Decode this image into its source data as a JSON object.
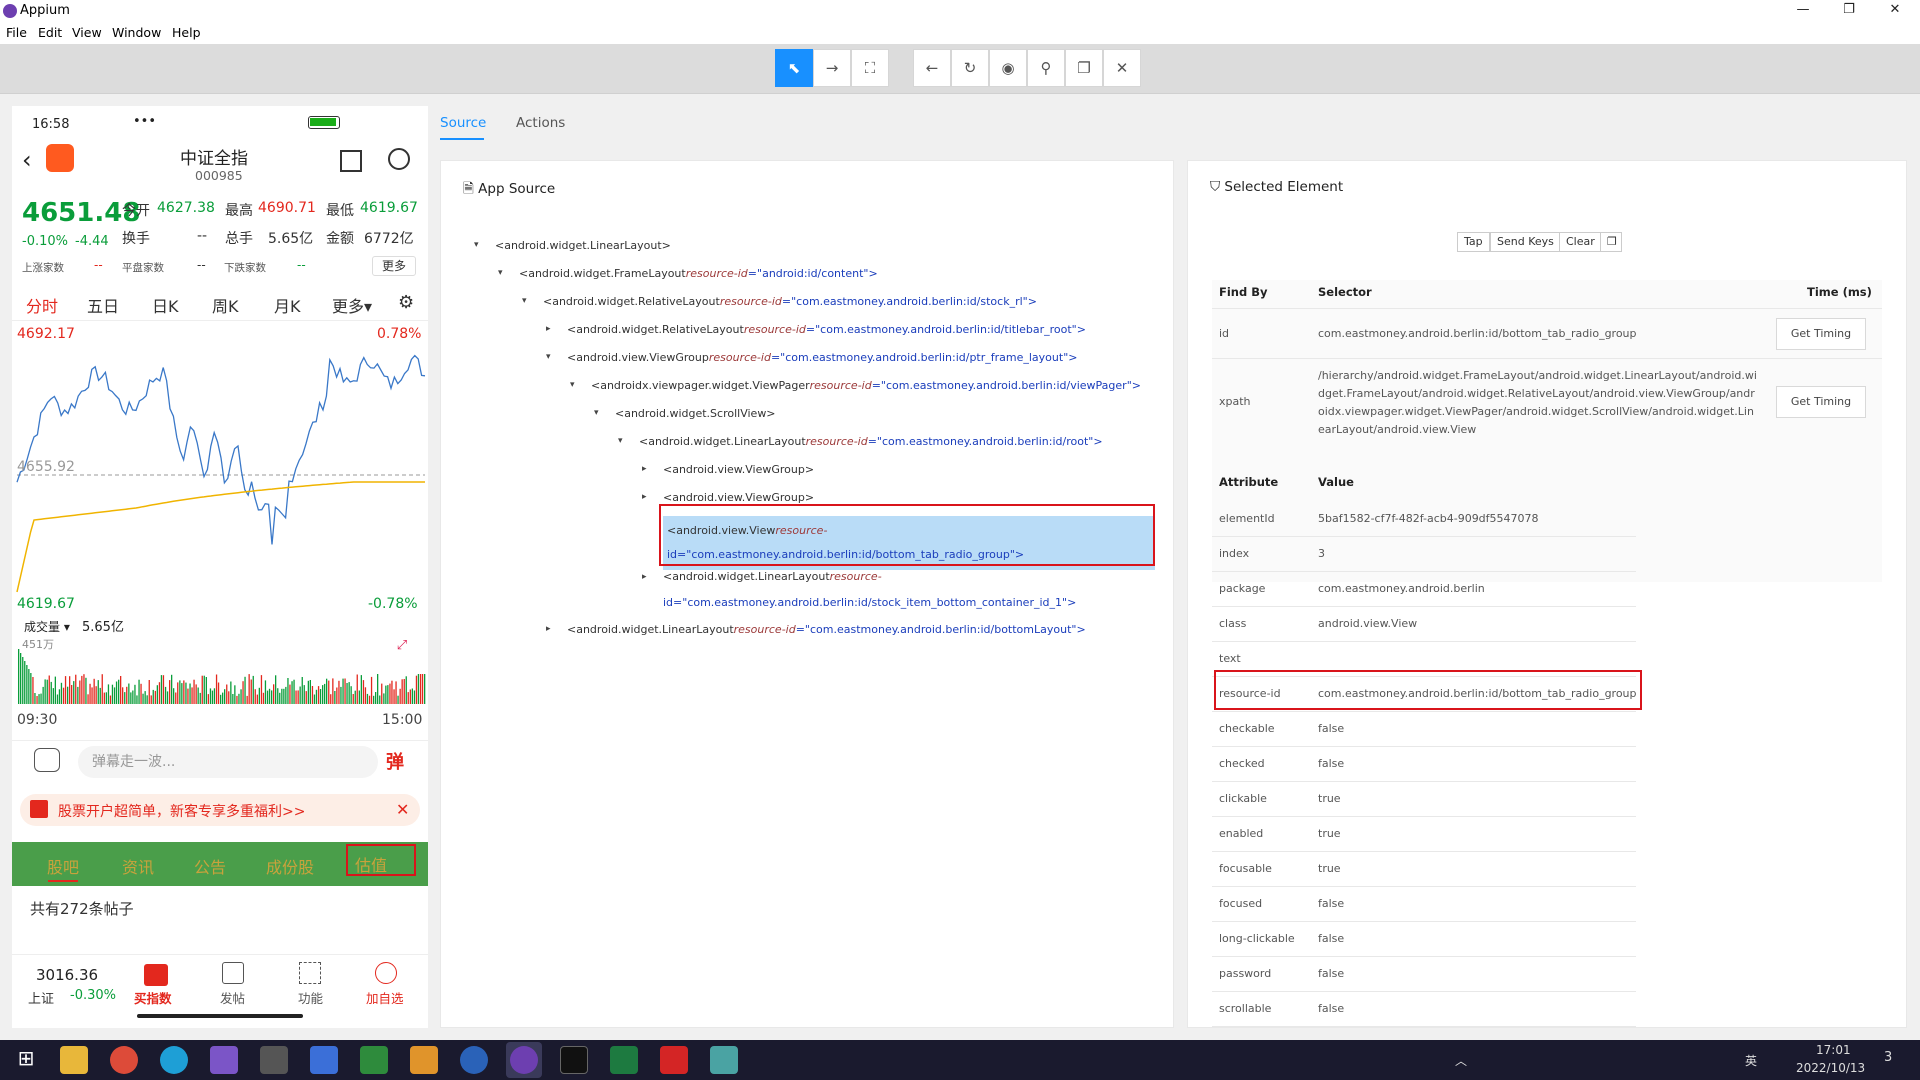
{
  "window": {
    "title": "Appium",
    "minimize": "—",
    "maximize": "❐",
    "close": "✕"
  },
  "menu": [
    "File",
    "Edit",
    "View",
    "Window",
    "Help"
  ],
  "toolbar": {
    "icons": [
      "select-icon",
      "swipe-icon",
      "tap-area-icon",
      "back-icon",
      "refresh-icon",
      "eye-icon",
      "search-icon",
      "copy-icon",
      "close-icon"
    ]
  },
  "phone": {
    "status_time": "16:58",
    "status_dots": "•••",
    "title": "中证全指",
    "code": "000985",
    "price": "4651.48",
    "change_pct": "-0.10%",
    "change_val": "-4.44",
    "open_label": "今开",
    "open_val": "4627.38",
    "high_label": "最高",
    "high_val": "4690.71",
    "low_label": "最低",
    "low_val": "4619.67",
    "turnover_label": "换手",
    "turnover_val": "--",
    "total_label": "总手",
    "total_val": "5.65亿",
    "amount_label": "金额",
    "amount_val": "6772亿",
    "up_label": "上涨家数",
    "up_val": "--",
    "flat_label": "平盘家数",
    "flat_val": "--",
    "down_label": "下跌家数",
    "down_val": "--",
    "more_btn": "更多",
    "period_tabs": [
      "分时",
      "五日",
      "日K",
      "周K",
      "月K",
      "更多▾"
    ],
    "chart_top": "4692.17",
    "chart_top_pct": "0.78%",
    "chart_mid": "4655.92",
    "chart_bottom": "4619.67",
    "chart_bottom_pct": "-0.78%",
    "volume_label": "成交量 ▾",
    "volume_val": "5.65亿",
    "volume_max": "451万",
    "time_start": "09:30",
    "time_end": "15:00",
    "danmu_placeholder": "弹幕走一波...",
    "danmu_btn": "弹",
    "promo_text": "股票开户超简单，新客专享多重福利>>",
    "promo_close": "✕",
    "bottom_tabs": [
      "股吧",
      "资讯",
      "公告",
      "成份股",
      "估值"
    ],
    "posts_text": "共有272条帖子",
    "nav_index_val": "3016.36",
    "nav_index_label": "上证",
    "nav_index_pct": "-0.30%",
    "nav_items": [
      "买指数",
      "发帖",
      "功能",
      "加自选"
    ]
  },
  "inspector": {
    "tab_source": "Source",
    "tab_actions": "Actions",
    "app_source_title": "App Source",
    "selected_title": "Selected Element",
    "actions": [
      "Tap",
      "Send Keys",
      "Clear"
    ],
    "tree": [
      {
        "tag": "<android.widget.LinearLayout>",
        "rid": "",
        "rv": ""
      },
      {
        "tag": "<android.widget.FrameLayout",
        "rid": "resource-id",
        "rv": "=\"android:id/content\">"
      },
      {
        "tag": "<android.widget.RelativeLayout",
        "rid": "resource-id",
        "rv": "=\"com.eastmoney.android.berlin:id/stock_rl\">"
      },
      {
        "tag": "<android.widget.RelativeLayout",
        "rid": "resource-id",
        "rv": "=\"com.eastmoney.android.berlin:id/titlebar_root\">"
      },
      {
        "tag": "<android.view.ViewGroup",
        "rid": "resource-id",
        "rv": "=\"com.eastmoney.android.berlin:id/ptr_frame_layout\">"
      },
      {
        "tag": "<androidx.viewpager.widget.ViewPager",
        "rid": "resource-id",
        "rv": "=\"com.eastmoney.android.berlin:id/viewPager\">"
      },
      {
        "tag": "<android.widget.ScrollView>",
        "rid": "",
        "rv": ""
      },
      {
        "tag": "<android.widget.LinearLayout",
        "rid": "resource-id",
        "rv": "=\"com.eastmoney.android.berlin:id/root\">"
      },
      {
        "tag": "<android.view.ViewGroup>",
        "rid": "",
        "rv": ""
      },
      {
        "tag": "<android.view.ViewGroup>",
        "rid": "",
        "rv": ""
      },
      {
        "tag": "<android.view.View",
        "rid": "resource-",
        "rv": "id=\"com.eastmoney.android.berlin:id/bottom_tab_radio_group\">"
      },
      {
        "tag": "<android.widget.LinearLayout",
        "rid": "resource-",
        "rv": "id=\"com.eastmoney.android.berlin:id/stock_item_bottom_container_id_1\">"
      },
      {
        "tag": "<android.widget.LinearLayout",
        "rid": "resource-id",
        "rv": "=\"com.eastmoney.android.berlin:id/bottomLayout\">"
      }
    ],
    "find_by": {
      "col_find": "Find By",
      "col_selector": "Selector",
      "col_time": "Time (ms)",
      "rows": [
        {
          "by": "id",
          "selector": "com.eastmoney.android.berlin:id/bottom_tab_radio_group",
          "btn": "Get Timing"
        },
        {
          "by": "xpath",
          "selector": "/hierarchy/android.widget.FrameLayout/android.widget.LinearLayout/android.widget.FrameLayout/android.widget.RelativeLayout/android.view.ViewGroup/androidx.viewpager.widget.ViewPager/android.widget.ScrollView/android.widget.LinearLayout/android.view.View",
          "btn": "Get Timing"
        }
      ]
    },
    "attributes": {
      "col_attr": "Attribute",
      "col_value": "Value",
      "rows": [
        {
          "k": "elementId",
          "v": "5baf1582-cf7f-482f-acb4-909df5547078"
        },
        {
          "k": "index",
          "v": "3"
        },
        {
          "k": "package",
          "v": "com.eastmoney.android.berlin"
        },
        {
          "k": "class",
          "v": "android.view.View"
        },
        {
          "k": "text",
          "v": ""
        },
        {
          "k": "resource-id",
          "v": "com.eastmoney.android.berlin:id/bottom_tab_radio_group"
        },
        {
          "k": "checkable",
          "v": "false"
        },
        {
          "k": "checked",
          "v": "false"
        },
        {
          "k": "clickable",
          "v": "true"
        },
        {
          "k": "enabled",
          "v": "true"
        },
        {
          "k": "focusable",
          "v": "true"
        },
        {
          "k": "focused",
          "v": "false"
        },
        {
          "k": "long-clickable",
          "v": "false"
        },
        {
          "k": "password",
          "v": "false"
        },
        {
          "k": "scrollable",
          "v": "false"
        }
      ]
    }
  },
  "taskbar": {
    "time": "17:01",
    "date": "2022/10/13",
    "ime": "英",
    "notif_count": "3"
  }
}
